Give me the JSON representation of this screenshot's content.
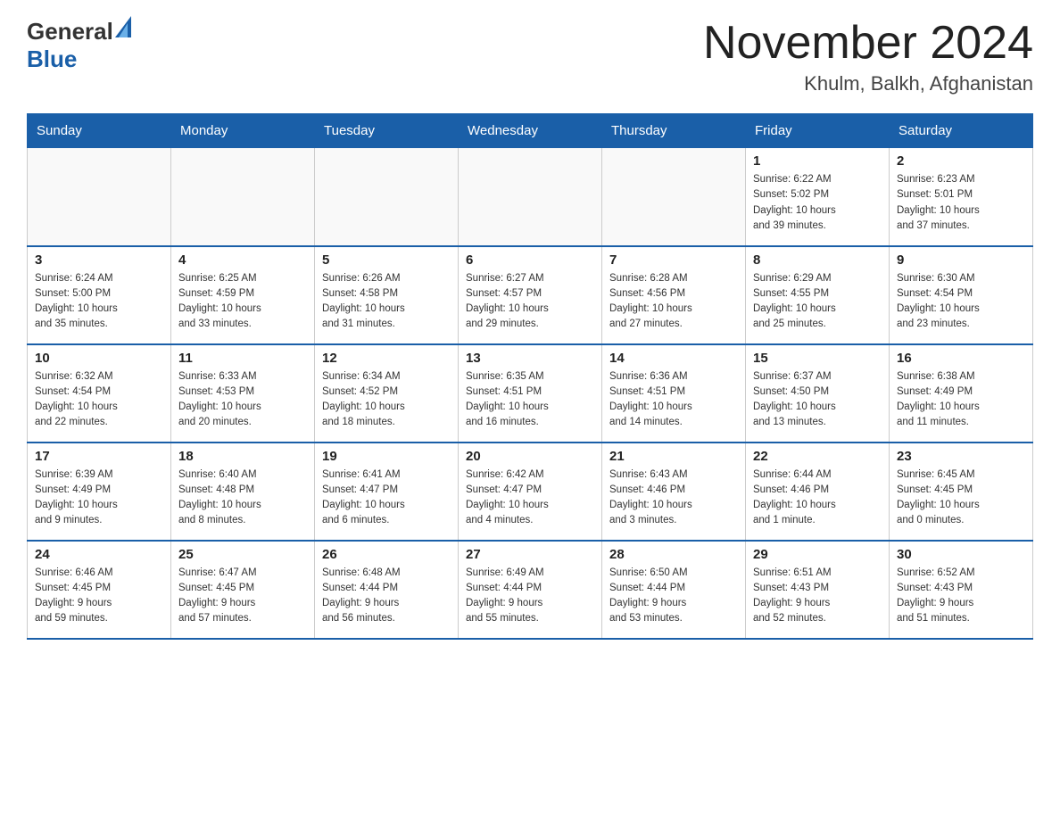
{
  "header": {
    "logo_general": "General",
    "logo_blue": "Blue",
    "month_title": "November 2024",
    "location": "Khulm, Balkh, Afghanistan"
  },
  "days_of_week": [
    "Sunday",
    "Monday",
    "Tuesday",
    "Wednesday",
    "Thursday",
    "Friday",
    "Saturday"
  ],
  "weeks": [
    [
      {
        "day": "",
        "info": ""
      },
      {
        "day": "",
        "info": ""
      },
      {
        "day": "",
        "info": ""
      },
      {
        "day": "",
        "info": ""
      },
      {
        "day": "",
        "info": ""
      },
      {
        "day": "1",
        "info": "Sunrise: 6:22 AM\nSunset: 5:02 PM\nDaylight: 10 hours\nand 39 minutes."
      },
      {
        "day": "2",
        "info": "Sunrise: 6:23 AM\nSunset: 5:01 PM\nDaylight: 10 hours\nand 37 minutes."
      }
    ],
    [
      {
        "day": "3",
        "info": "Sunrise: 6:24 AM\nSunset: 5:00 PM\nDaylight: 10 hours\nand 35 minutes."
      },
      {
        "day": "4",
        "info": "Sunrise: 6:25 AM\nSunset: 4:59 PM\nDaylight: 10 hours\nand 33 minutes."
      },
      {
        "day": "5",
        "info": "Sunrise: 6:26 AM\nSunset: 4:58 PM\nDaylight: 10 hours\nand 31 minutes."
      },
      {
        "day": "6",
        "info": "Sunrise: 6:27 AM\nSunset: 4:57 PM\nDaylight: 10 hours\nand 29 minutes."
      },
      {
        "day": "7",
        "info": "Sunrise: 6:28 AM\nSunset: 4:56 PM\nDaylight: 10 hours\nand 27 minutes."
      },
      {
        "day": "8",
        "info": "Sunrise: 6:29 AM\nSunset: 4:55 PM\nDaylight: 10 hours\nand 25 minutes."
      },
      {
        "day": "9",
        "info": "Sunrise: 6:30 AM\nSunset: 4:54 PM\nDaylight: 10 hours\nand 23 minutes."
      }
    ],
    [
      {
        "day": "10",
        "info": "Sunrise: 6:32 AM\nSunset: 4:54 PM\nDaylight: 10 hours\nand 22 minutes."
      },
      {
        "day": "11",
        "info": "Sunrise: 6:33 AM\nSunset: 4:53 PM\nDaylight: 10 hours\nand 20 minutes."
      },
      {
        "day": "12",
        "info": "Sunrise: 6:34 AM\nSunset: 4:52 PM\nDaylight: 10 hours\nand 18 minutes."
      },
      {
        "day": "13",
        "info": "Sunrise: 6:35 AM\nSunset: 4:51 PM\nDaylight: 10 hours\nand 16 minutes."
      },
      {
        "day": "14",
        "info": "Sunrise: 6:36 AM\nSunset: 4:51 PM\nDaylight: 10 hours\nand 14 minutes."
      },
      {
        "day": "15",
        "info": "Sunrise: 6:37 AM\nSunset: 4:50 PM\nDaylight: 10 hours\nand 13 minutes."
      },
      {
        "day": "16",
        "info": "Sunrise: 6:38 AM\nSunset: 4:49 PM\nDaylight: 10 hours\nand 11 minutes."
      }
    ],
    [
      {
        "day": "17",
        "info": "Sunrise: 6:39 AM\nSunset: 4:49 PM\nDaylight: 10 hours\nand 9 minutes."
      },
      {
        "day": "18",
        "info": "Sunrise: 6:40 AM\nSunset: 4:48 PM\nDaylight: 10 hours\nand 8 minutes."
      },
      {
        "day": "19",
        "info": "Sunrise: 6:41 AM\nSunset: 4:47 PM\nDaylight: 10 hours\nand 6 minutes."
      },
      {
        "day": "20",
        "info": "Sunrise: 6:42 AM\nSunset: 4:47 PM\nDaylight: 10 hours\nand 4 minutes."
      },
      {
        "day": "21",
        "info": "Sunrise: 6:43 AM\nSunset: 4:46 PM\nDaylight: 10 hours\nand 3 minutes."
      },
      {
        "day": "22",
        "info": "Sunrise: 6:44 AM\nSunset: 4:46 PM\nDaylight: 10 hours\nand 1 minute."
      },
      {
        "day": "23",
        "info": "Sunrise: 6:45 AM\nSunset: 4:45 PM\nDaylight: 10 hours\nand 0 minutes."
      }
    ],
    [
      {
        "day": "24",
        "info": "Sunrise: 6:46 AM\nSunset: 4:45 PM\nDaylight: 9 hours\nand 59 minutes."
      },
      {
        "day": "25",
        "info": "Sunrise: 6:47 AM\nSunset: 4:45 PM\nDaylight: 9 hours\nand 57 minutes."
      },
      {
        "day": "26",
        "info": "Sunrise: 6:48 AM\nSunset: 4:44 PM\nDaylight: 9 hours\nand 56 minutes."
      },
      {
        "day": "27",
        "info": "Sunrise: 6:49 AM\nSunset: 4:44 PM\nDaylight: 9 hours\nand 55 minutes."
      },
      {
        "day": "28",
        "info": "Sunrise: 6:50 AM\nSunset: 4:44 PM\nDaylight: 9 hours\nand 53 minutes."
      },
      {
        "day": "29",
        "info": "Sunrise: 6:51 AM\nSunset: 4:43 PM\nDaylight: 9 hours\nand 52 minutes."
      },
      {
        "day": "30",
        "info": "Sunrise: 6:52 AM\nSunset: 4:43 PM\nDaylight: 9 hours\nand 51 minutes."
      }
    ]
  ]
}
